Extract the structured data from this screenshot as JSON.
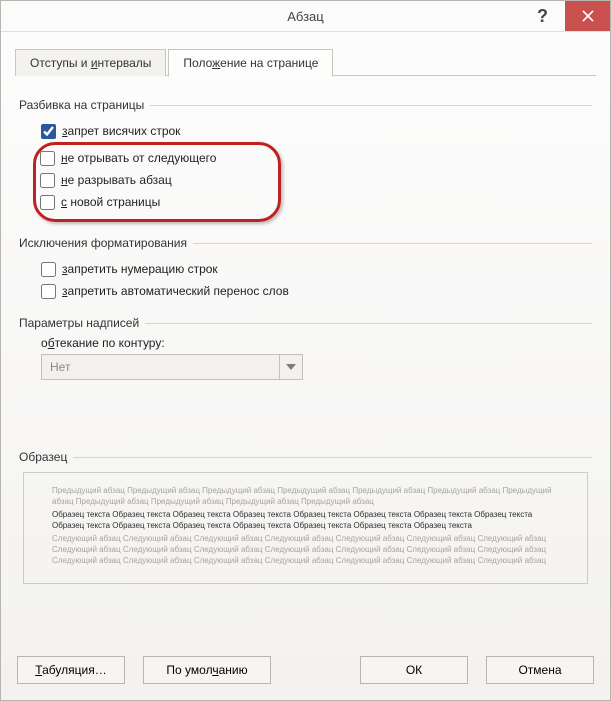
{
  "title": "Абзац",
  "tabs": {
    "indent": "Отступы и интервалы",
    "position": "Положение на странице"
  },
  "groups": {
    "pagination": {
      "label": "Разбивка на страницы",
      "widow": {
        "text": "запрет висячих строк",
        "hotkey": "з"
      },
      "keepNext": {
        "text": "не отрывать от следующего",
        "hotkey": "н"
      },
      "keepTogether": {
        "text": "не разрывать абзац",
        "hotkey": "н"
      },
      "pageBreak": {
        "text": "с новой страницы",
        "hotkey": "с"
      }
    },
    "exceptions": {
      "label": "Исключения форматирования",
      "noLineNum": {
        "text": "запретить нумерацию строк",
        "hotkey": "з"
      },
      "noHyphen": {
        "text": "запретить автоматический перенос слов",
        "hotkey": "з"
      }
    },
    "textbox": {
      "label": "Параметры надписей",
      "wrapLabel": "обтекание по контуру:",
      "wrapHotkey": "б",
      "wrapValue": "Нет"
    },
    "preview": {
      "label": "Образец",
      "prev": "Предыдущий абзац Предыдущий абзац Предыдущий абзац Предыдущий абзац Предыдущий абзац Предыдущий абзац Предыдущий абзац Предыдущий абзац Предыдущий абзац Предыдущий абзац Предыдущий абзац",
      "sample": "Образец текста Образец текста Образец текста Образец текста Образец текста Образец текста Образец текста Образец текста Образец текста Образец текста Образец текста Образец текста Образец текста Образец текста Образец текста",
      "next": "Следующий абзац Следующий абзац Следующий абзац Следующий абзац Следующий абзац Следующий абзац Следующий абзац Следующий абзац Следующий абзац Следующий абзац Следующий абзац Следующий абзац Следующий абзац Следующий абзац Следующий абзац Следующий абзац Следующий абзац Следующий абзац Следующий абзац Следующий абзац Следующий абзац"
    }
  },
  "buttons": {
    "tabs": "Табуляция…",
    "defaults": "По умолчанию",
    "ok": "ОК",
    "cancel": "Отмена"
  },
  "state": {
    "widow": true,
    "keepNext": false,
    "keepTogether": false,
    "pageBreak": false,
    "noLineNum": false,
    "noHyphen": false,
    "wrapDisabled": true
  }
}
